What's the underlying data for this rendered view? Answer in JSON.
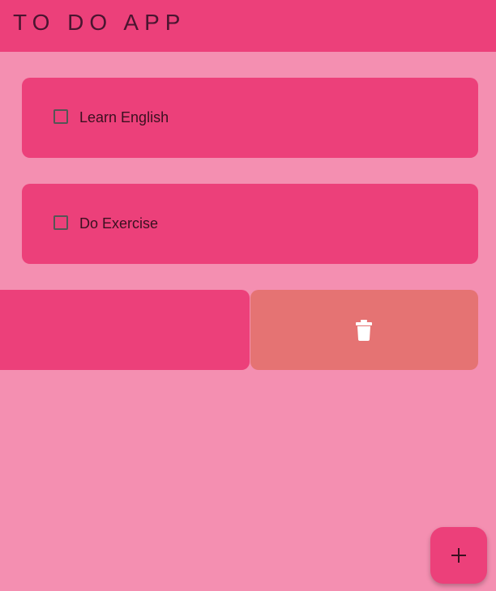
{
  "app_bar": {
    "title": "TO DO APP"
  },
  "tasks": [
    {
      "title": "Learn English",
      "checked": false
    },
    {
      "title": "Do Exercise",
      "checked": false
    },
    {
      "title": "",
      "checked": false,
      "swiped": true
    }
  ],
  "swipe_action": {
    "icon": "trash-icon"
  },
  "fab": {
    "icon": "plus-icon"
  },
  "colors": {
    "background": "#f48fb1",
    "primary": "#ec407a",
    "delete": "#e57373"
  }
}
